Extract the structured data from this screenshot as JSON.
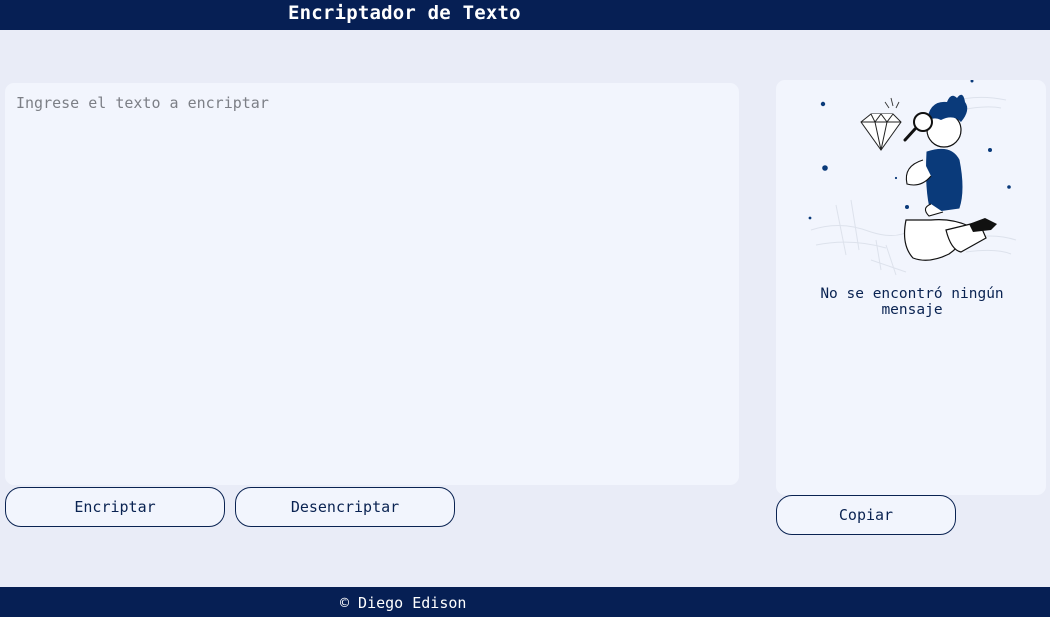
{
  "header": {
    "title": "Encriptador de Texto"
  },
  "input": {
    "placeholder": "Ingrese el texto a encriptar",
    "value": ""
  },
  "buttons": {
    "encrypt_label": "Encriptar",
    "decrypt_label": "Desencriptar",
    "copy_label": "Copiar"
  },
  "result": {
    "message": "No se encontró ningún mensaje",
    "illustration_icon": "person-with-magnifier-and-diamond-illustration"
  },
  "footer": {
    "text": "© Diego Edison"
  },
  "colors": {
    "navy": "#061f54",
    "panel": "#f2f5fd",
    "background": "#e9ecf7",
    "accent": "#0a3a7a"
  }
}
